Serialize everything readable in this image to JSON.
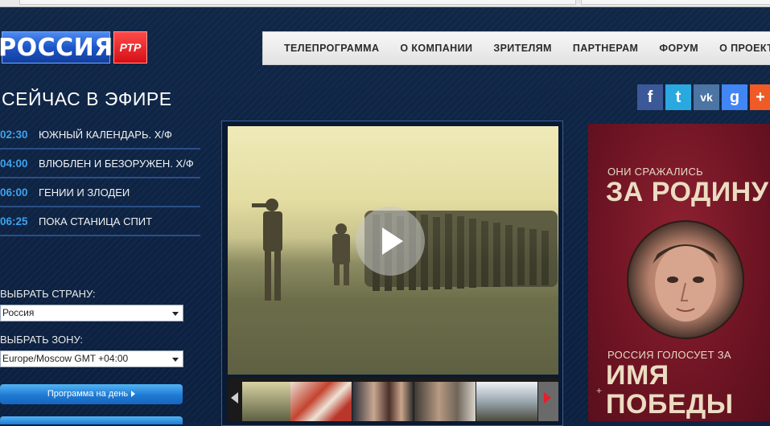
{
  "header": {
    "logo_text": "РОССИЯ",
    "logo_badge": "РТР",
    "nav": [
      "ТЕЛЕПРОГРАММА",
      "О КОМПАНИИ",
      "ЗРИТЕЛЯМ",
      "ПАРТНЕРАМ",
      "ФОРУМ",
      "О ПРОЕКТАХ"
    ]
  },
  "onair": {
    "title": "СЕЙЧАС В ЭФИРЕ",
    "items": [
      {
        "time": "02:30",
        "title": "ЮЖНЫЙ КАЛЕНДАРЬ. Х/Ф"
      },
      {
        "time": "04:00",
        "title": "ВЛЮБЛЕН И БЕЗОРУЖЕН. Х/Ф"
      },
      {
        "time": "06:00",
        "title": "ГЕНИИ И ЗЛОДЕИ"
      },
      {
        "time": "06:25",
        "title": "ПОКА СТАНИЦА СПИТ"
      }
    ]
  },
  "filters": {
    "country_label": "ВЫБРАТЬ СТРАНУ:",
    "country_value": "Россия",
    "zone_label": "ВЫБРАТЬ ЗОНУ:",
    "zone_value": "Europe/Moscow GMT +04:00",
    "day_button": "Программа на день"
  },
  "social": [
    {
      "name": "facebook",
      "glyph": "f",
      "color": "#3b5998"
    },
    {
      "name": "twitter",
      "glyph": "t",
      "color": "#2aa9e0"
    },
    {
      "name": "vkontakte",
      "glyph": "vk",
      "color": "#4c75a3"
    },
    {
      "name": "google",
      "glyph": "g",
      "color": "#4285f4"
    },
    {
      "name": "more",
      "glyph": "+",
      "color": "#f05a24"
    }
  ],
  "ad": {
    "line1": "ОНИ СРАЖАЛИСЬ",
    "line2": "ЗА РОДИНУ",
    "line3": "РОССИЯ ГОЛОСУЕТ ЗА",
    "line4": "ИМЯ",
    "line5": "ПОБЕДЫ"
  }
}
